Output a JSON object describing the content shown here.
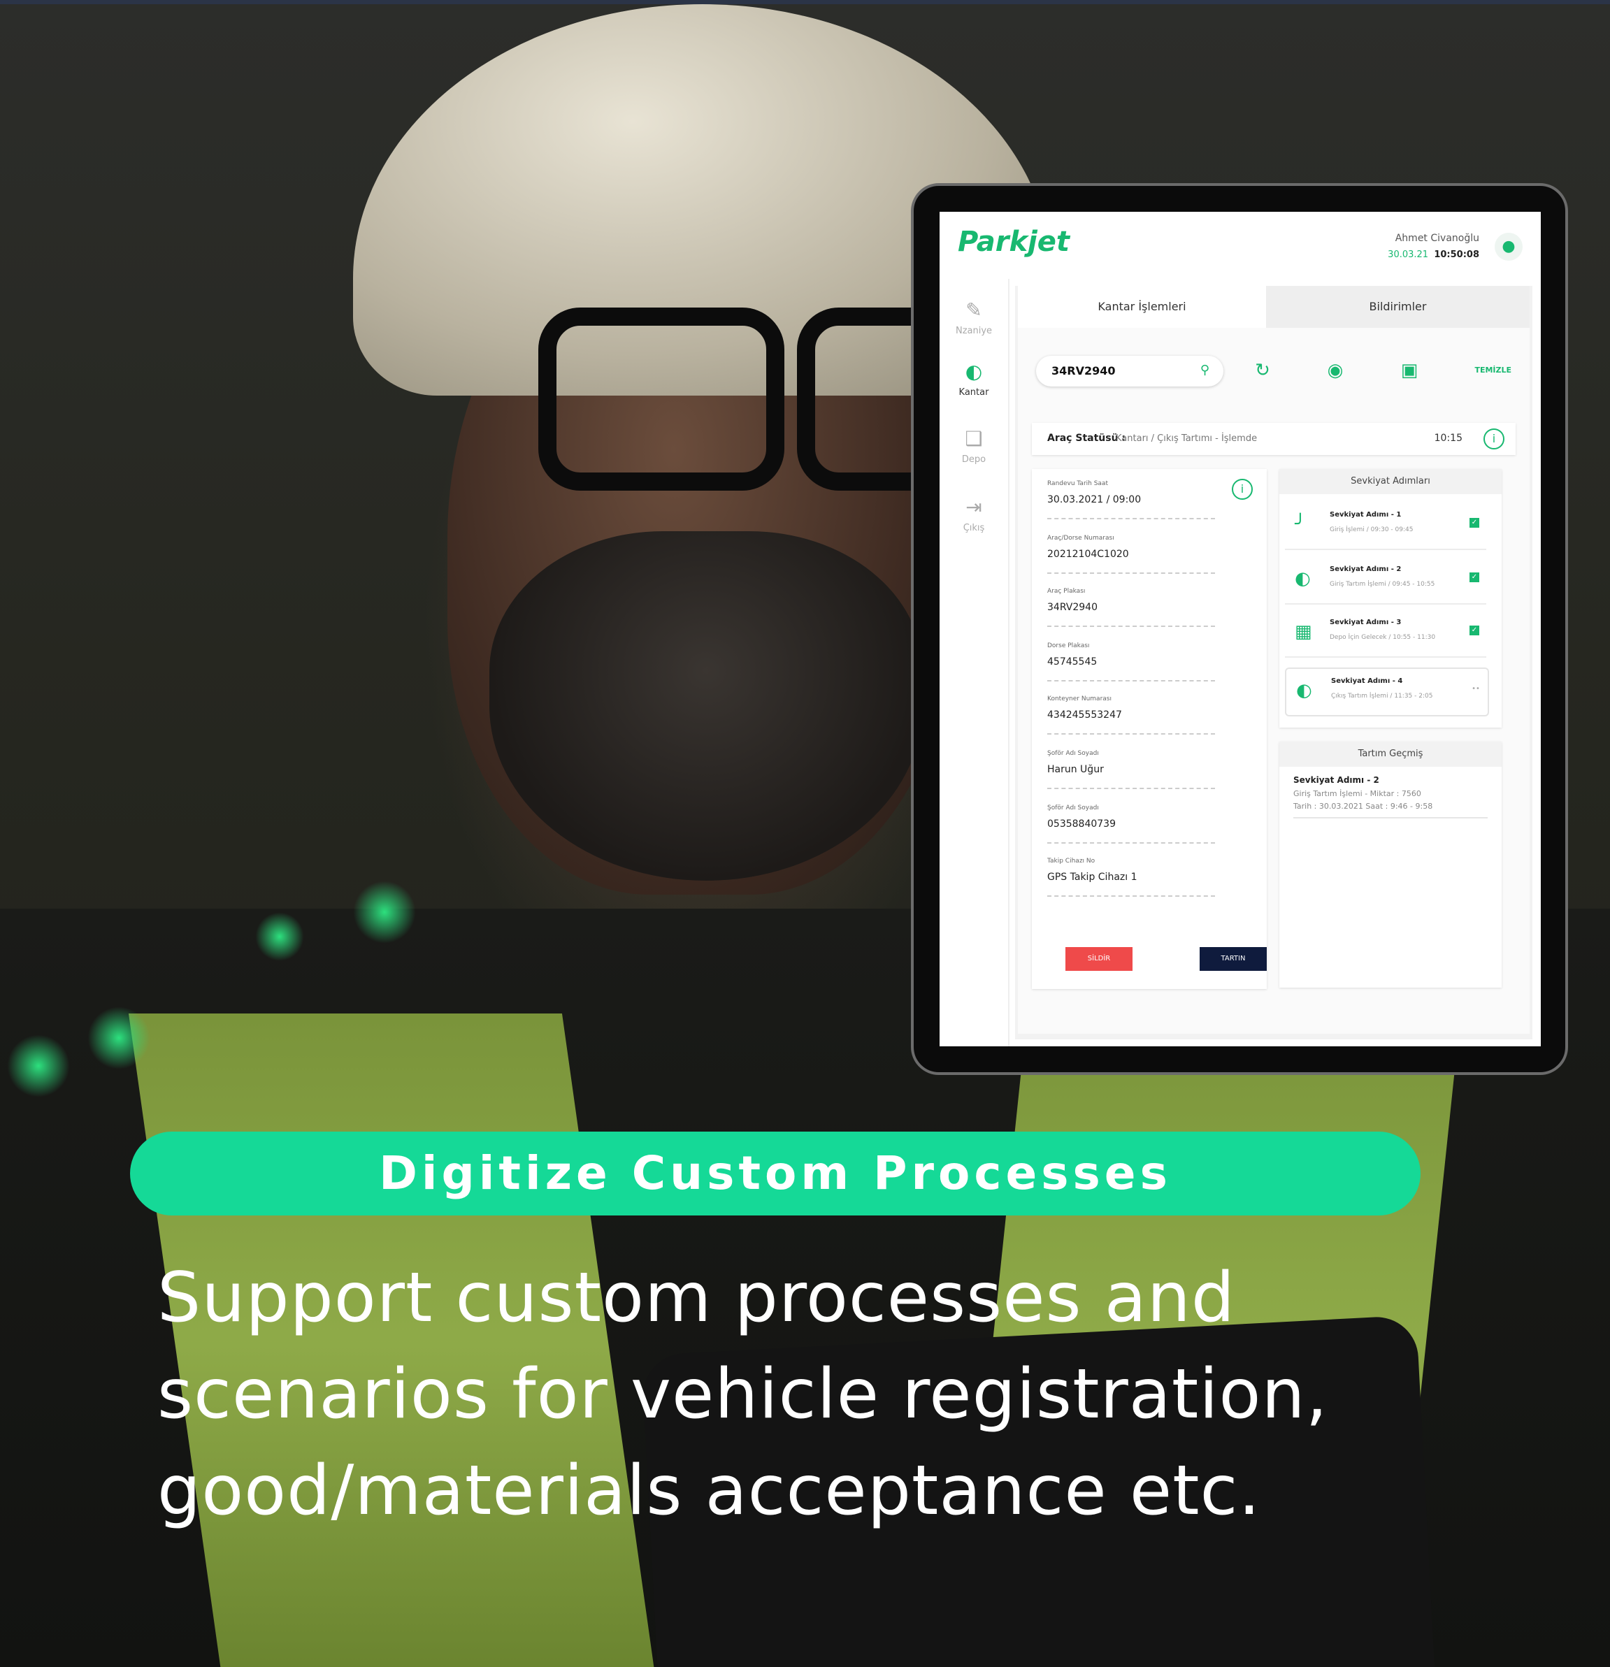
{
  "colors": {
    "accent": "#15d997",
    "brand_green": "#18b870",
    "danger": "#ef4a4a",
    "navy": "#0f1b3d"
  },
  "app": {
    "logo": "Parkjet",
    "user_name": "Ahmet Civanoğlu",
    "user_date": "30.03.21",
    "user_time": "10:50:08",
    "sidebar": [
      {
        "label": "Nzaniye",
        "icon": "edit-icon"
      },
      {
        "label": "Kantar",
        "icon": "gauge-icon"
      },
      {
        "label": "Depo",
        "icon": "box-icon"
      },
      {
        "label": "Çıkış",
        "icon": "exit-icon"
      }
    ],
    "tabs": [
      "Kantar İşlemleri",
      "Bildirimler"
    ],
    "search_value": "34RV2940",
    "clear_label": "TEMİZLE",
    "status_label": "Araç Statüsü :",
    "status_value": "Kantarı / Çıkış Tartımı - İşlemde",
    "status_time": "10:15",
    "fields": [
      {
        "label": "Randevu Tarih Saat",
        "value": "30.03.2021 / 09:00"
      },
      {
        "label": "Araç/Dorse Numarası",
        "value": "20212104C1020"
      },
      {
        "label": "Araç Plakası",
        "value": "34RV2940"
      },
      {
        "label": "Dorse Plakası",
        "value": "45745545"
      },
      {
        "label": "Konteyner Numarası",
        "value": "434245553247"
      },
      {
        "label": "Şoför Adı Soyadı",
        "value": "Harun Uğur"
      },
      {
        "label": "Şoför Adı Soyadı",
        "value": "05358840739"
      },
      {
        "label": "Takip Cihazı No",
        "value": "GPS Takip Cihazı 1"
      }
    ],
    "btn_delete": "SİLDİR",
    "btn_weigh": "TARTIN",
    "shipment_title": "Sevkiyat Adımları",
    "steps": [
      {
        "title": "Sevkiyat Adımı - 1",
        "sub": "Giriş İşlemi / 09:30 - 09:45",
        "done": true
      },
      {
        "title": "Sevkiyat Adımı - 2",
        "sub": "Giriş Tartım İşlemi / 09:45 - 10:55",
        "done": true
      },
      {
        "title": "Sevkiyat Adımı - 3",
        "sub": "Depo İçin Gelecek / 10:55 - 11:30",
        "done": true
      },
      {
        "title": "Sevkiyat Adımı - 4",
        "sub": "Çıkış Tartım İşlemi / 11:35 - 2:05",
        "done": false
      }
    ],
    "history_title": "Tartım Geçmiş",
    "history": {
      "title": "Sevkiyat Adımı - 2",
      "line1": "Giriş Tartım İşlemi - Miktar : 7560",
      "line2": "Tarih : 30.03.2021 Saat : 9:46 - 9:58"
    }
  },
  "banner": "Digitize Custom Processes",
  "caption": [
    "Support custom processes and",
    "scenarios for vehicle registration,",
    "good/materials acceptance etc."
  ]
}
